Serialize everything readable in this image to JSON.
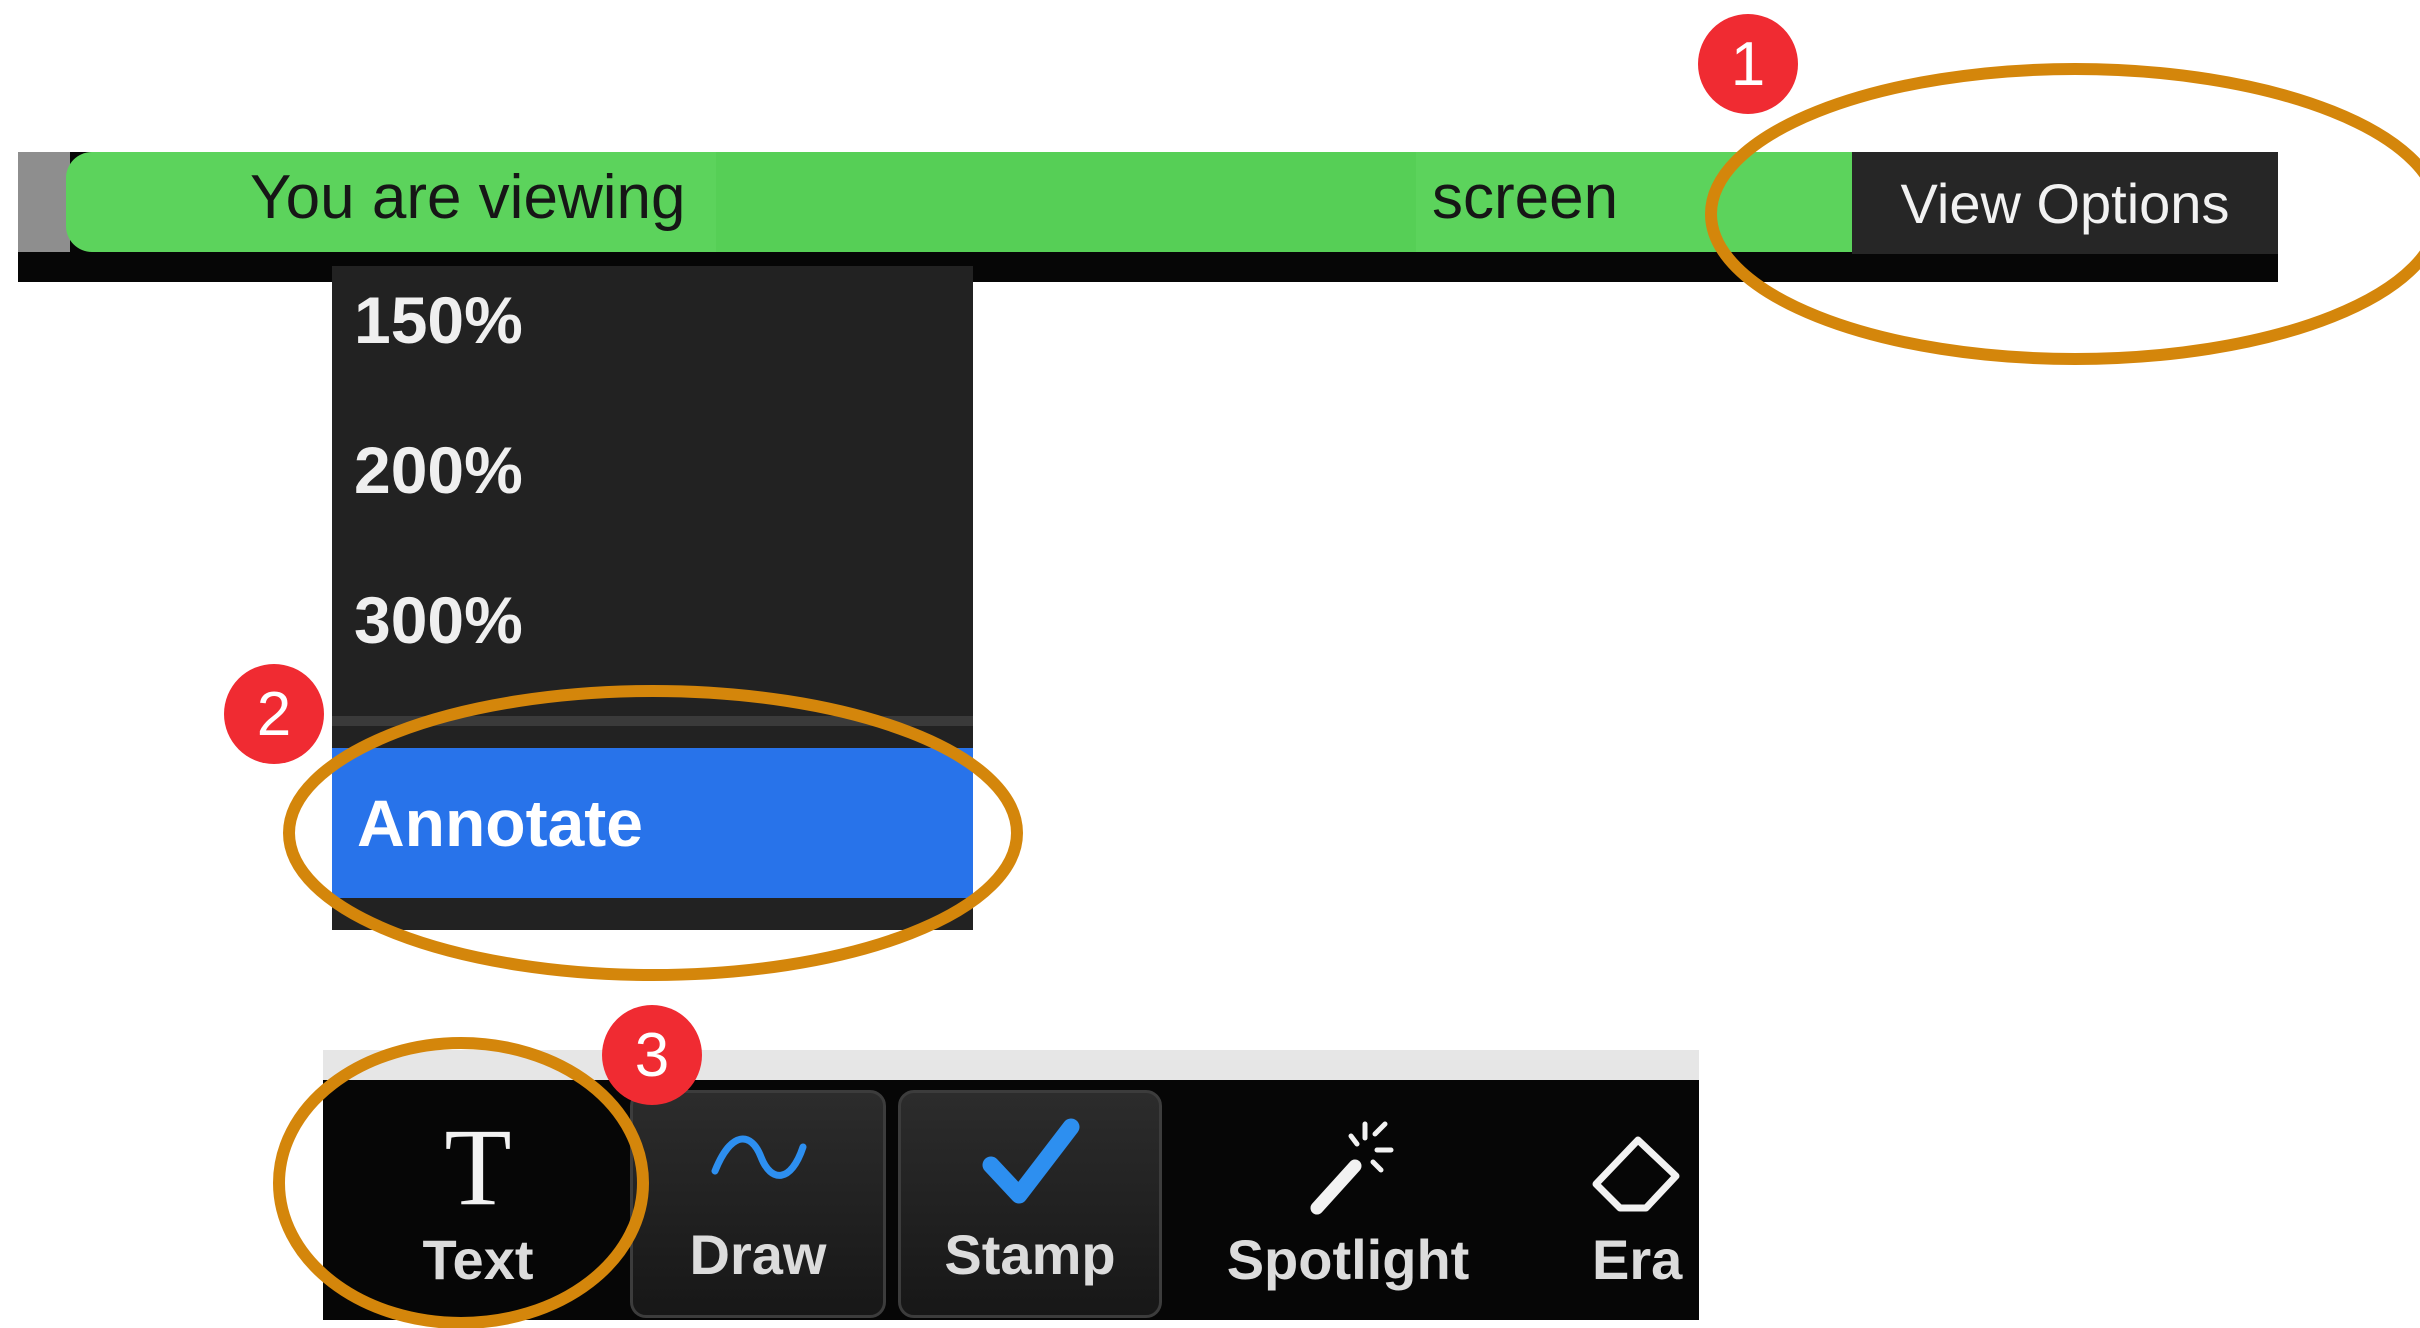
{
  "share_bar": {
    "viewing_prefix": "You are viewing",
    "viewing_suffix": "screen",
    "view_options_label": "View Options"
  },
  "view_menu": {
    "zoom_items": [
      "150%",
      "200%",
      "300%"
    ],
    "annotate_label": "Annotate"
  },
  "annotation_toolbar": {
    "tools": [
      {
        "label": "Text",
        "icon": "text-t-icon"
      },
      {
        "label": "Draw",
        "icon": "wave-line-icon"
      },
      {
        "label": "Stamp",
        "icon": "checkmark-icon"
      },
      {
        "label": "Spotlight",
        "icon": "magic-wand-icon"
      },
      {
        "label": "Eraser",
        "icon": "eraser-icon",
        "visible_label": "Era"
      }
    ]
  },
  "callouts": {
    "step_numbers": [
      "1",
      "2",
      "3"
    ]
  },
  "colors": {
    "share_bar_green": "#5cd35c",
    "highlight_blue": "#2873ea",
    "callout_ring_orange": "#d4860b",
    "badge_red": "#f02b32",
    "stamp_check_blue": "#2d8ff0"
  }
}
